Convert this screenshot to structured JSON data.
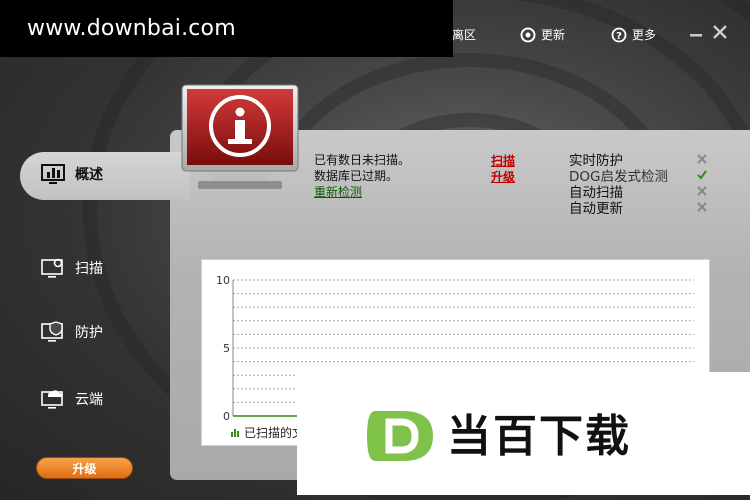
{
  "watermark_top": "www.downbai.com",
  "titlebar": {
    "community": "离区",
    "update": "更新",
    "more": "更多"
  },
  "sidebar": {
    "items": [
      {
        "label": "概述"
      },
      {
        "label": "扫描"
      },
      {
        "label": "防护"
      },
      {
        "label": "云端"
      }
    ],
    "upgrade_label": "升级"
  },
  "status": {
    "line1": "已有数日未扫描。",
    "line2": "数据库已过期。",
    "recheck": "重新检测",
    "scan_link": "扫描",
    "upgrade_link": "升级"
  },
  "protection": [
    {
      "label": "实时防护",
      "enabled": false
    },
    {
      "label": "DOG启发式检测",
      "enabled": true
    },
    {
      "label": "自动扫描",
      "enabled": false
    },
    {
      "label": "自动更新",
      "enabled": false
    }
  ],
  "chart_data": {
    "type": "line",
    "ylim": [
      0,
      10
    ],
    "yticks": [
      0,
      5,
      10
    ],
    "series": [
      {
        "name": "已扫描的文",
        "values": [
          0,
          0,
          0,
          0,
          0,
          0,
          0
        ]
      }
    ],
    "grid": true
  },
  "watermark_bottom": "当百下载",
  "colors": {
    "accent_red": "#c00000",
    "upgrade_orange": "#ee8628",
    "link_green": "#0a5c0a"
  }
}
